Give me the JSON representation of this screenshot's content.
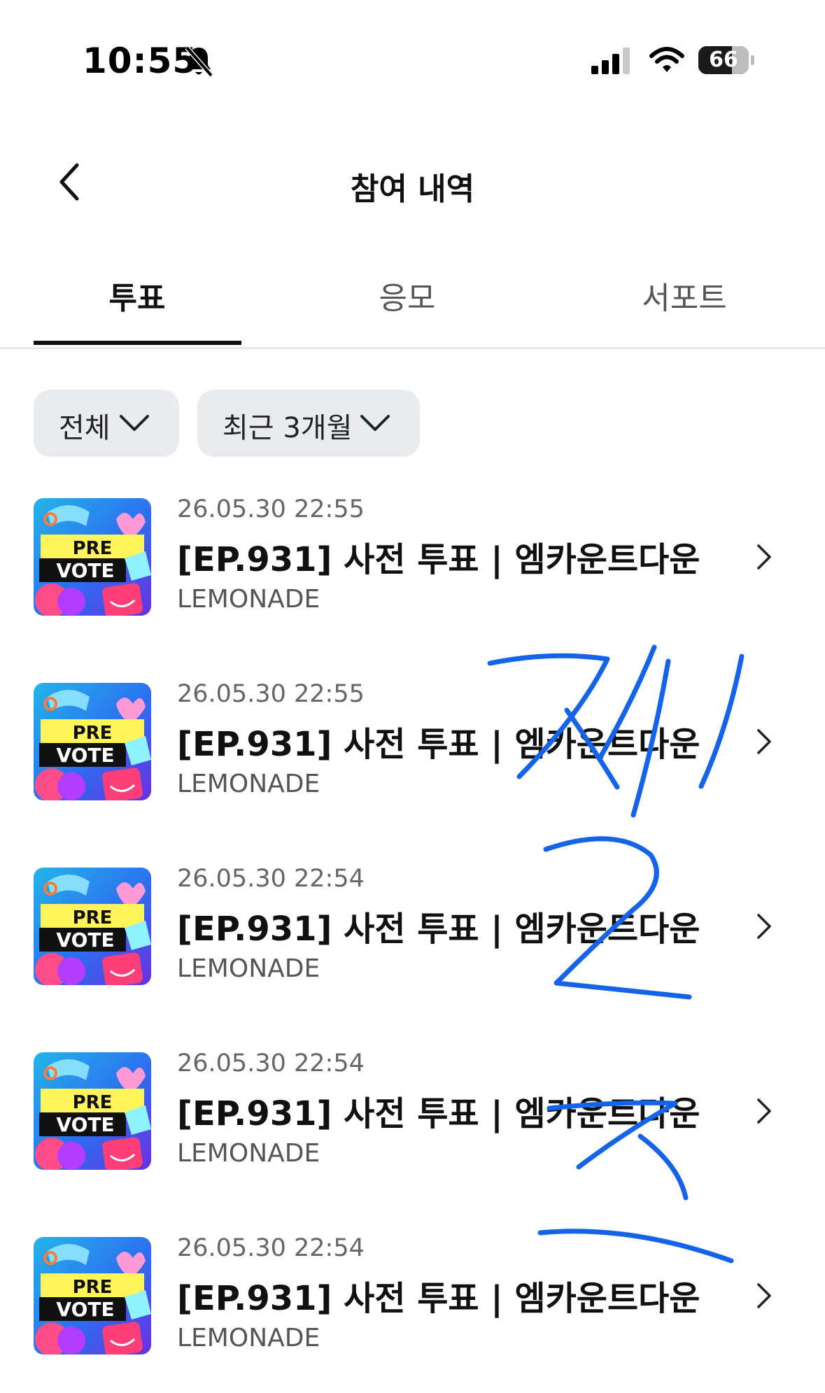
{
  "status_bar": {
    "time": "10:55",
    "silent_icon": "bell-slash-icon",
    "signal_icon": "cellular-signal-icon",
    "wifi_icon": "wifi-icon",
    "battery_level": 66,
    "battery_text": "66"
  },
  "nav": {
    "back_icon": "chevron-left-icon",
    "title": "참여 내역"
  },
  "tabs": [
    {
      "label": "투표",
      "active": true
    },
    {
      "label": "응모",
      "active": false
    },
    {
      "label": "서포트",
      "active": false
    }
  ],
  "filters": {
    "category": "전체",
    "period": "최근 3개월",
    "chevron_icon": "chevron-down-icon"
  },
  "items": [
    {
      "date": "26.05.30 22:55",
      "title": "[EP.931] 사전 투표 | 엠카운트다운",
      "artist": "LEMONADE",
      "thumb_line1": "PRE",
      "thumb_line2": "VOTE"
    },
    {
      "date": "26.05.30 22:55",
      "title": "[EP.931] 사전 투표 | 엠카운트다운",
      "artist": "LEMONADE",
      "thumb_line1": "PRE",
      "thumb_line2": "VOTE"
    },
    {
      "date": "26.05.30 22:54",
      "title": "[EP.931] 사전 투표 | 엠카운트다운",
      "artist": "LEMONADE",
      "thumb_line1": "PRE",
      "thumb_line2": "VOTE"
    },
    {
      "date": "26.05.30 22:54",
      "title": "[EP.931] 사전 투표 | 엠카운트다운",
      "artist": "LEMONADE",
      "thumb_line1": "PRE",
      "thumb_line2": "VOTE"
    },
    {
      "date": "26.05.30 22:54",
      "title": "[EP.931] 사전 투표 | 엠카운트다운",
      "artist": "LEMONADE",
      "thumb_line1": "PRE",
      "thumb_line2": "VOTE"
    }
  ],
  "colors": {
    "scribble": "#1463e8",
    "filter_bg": "#eaebef",
    "text_primary": "#111111",
    "text_secondary": "#666666"
  }
}
